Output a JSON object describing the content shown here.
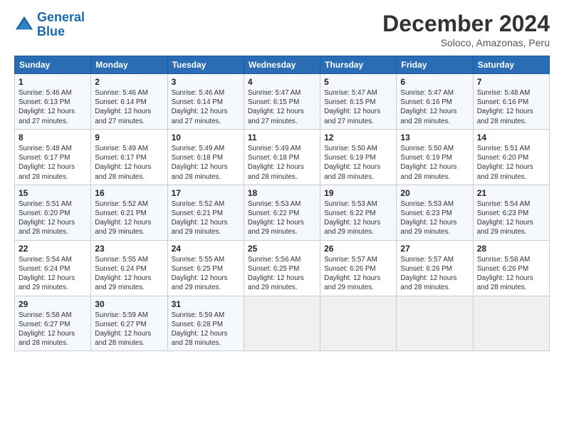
{
  "header": {
    "logo_line1": "General",
    "logo_line2": "Blue",
    "title": "December 2024",
    "subtitle": "Soloco, Amazonas, Peru"
  },
  "days_of_week": [
    "Sunday",
    "Monday",
    "Tuesday",
    "Wednesday",
    "Thursday",
    "Friday",
    "Saturday"
  ],
  "weeks": [
    [
      {
        "day": "1",
        "info": "Sunrise: 5:46 AM\nSunset: 6:13 PM\nDaylight: 12 hours\nand 27 minutes."
      },
      {
        "day": "2",
        "info": "Sunrise: 5:46 AM\nSunset: 6:14 PM\nDaylight: 12 hours\nand 27 minutes."
      },
      {
        "day": "3",
        "info": "Sunrise: 5:46 AM\nSunset: 6:14 PM\nDaylight: 12 hours\nand 27 minutes."
      },
      {
        "day": "4",
        "info": "Sunrise: 5:47 AM\nSunset: 6:15 PM\nDaylight: 12 hours\nand 27 minutes."
      },
      {
        "day": "5",
        "info": "Sunrise: 5:47 AM\nSunset: 6:15 PM\nDaylight: 12 hours\nand 27 minutes."
      },
      {
        "day": "6",
        "info": "Sunrise: 5:47 AM\nSunset: 6:16 PM\nDaylight: 12 hours\nand 28 minutes."
      },
      {
        "day": "7",
        "info": "Sunrise: 5:48 AM\nSunset: 6:16 PM\nDaylight: 12 hours\nand 28 minutes."
      }
    ],
    [
      {
        "day": "8",
        "info": "Sunrise: 5:48 AM\nSunset: 6:17 PM\nDaylight: 12 hours\nand 28 minutes."
      },
      {
        "day": "9",
        "info": "Sunrise: 5:49 AM\nSunset: 6:17 PM\nDaylight: 12 hours\nand 28 minutes."
      },
      {
        "day": "10",
        "info": "Sunrise: 5:49 AM\nSunset: 6:18 PM\nDaylight: 12 hours\nand 28 minutes."
      },
      {
        "day": "11",
        "info": "Sunrise: 5:49 AM\nSunset: 6:18 PM\nDaylight: 12 hours\nand 28 minutes."
      },
      {
        "day": "12",
        "info": "Sunrise: 5:50 AM\nSunset: 6:19 PM\nDaylight: 12 hours\nand 28 minutes."
      },
      {
        "day": "13",
        "info": "Sunrise: 5:50 AM\nSunset: 6:19 PM\nDaylight: 12 hours\nand 28 minutes."
      },
      {
        "day": "14",
        "info": "Sunrise: 5:51 AM\nSunset: 6:20 PM\nDaylight: 12 hours\nand 28 minutes."
      }
    ],
    [
      {
        "day": "15",
        "info": "Sunrise: 5:51 AM\nSunset: 6:20 PM\nDaylight: 12 hours\nand 28 minutes."
      },
      {
        "day": "16",
        "info": "Sunrise: 5:52 AM\nSunset: 6:21 PM\nDaylight: 12 hours\nand 29 minutes."
      },
      {
        "day": "17",
        "info": "Sunrise: 5:52 AM\nSunset: 6:21 PM\nDaylight: 12 hours\nand 29 minutes."
      },
      {
        "day": "18",
        "info": "Sunrise: 5:53 AM\nSunset: 6:22 PM\nDaylight: 12 hours\nand 29 minutes."
      },
      {
        "day": "19",
        "info": "Sunrise: 5:53 AM\nSunset: 6:22 PM\nDaylight: 12 hours\nand 29 minutes."
      },
      {
        "day": "20",
        "info": "Sunrise: 5:53 AM\nSunset: 6:23 PM\nDaylight: 12 hours\nand 29 minutes."
      },
      {
        "day": "21",
        "info": "Sunrise: 5:54 AM\nSunset: 6:23 PM\nDaylight: 12 hours\nand 29 minutes."
      }
    ],
    [
      {
        "day": "22",
        "info": "Sunrise: 5:54 AM\nSunset: 6:24 PM\nDaylight: 12 hours\nand 29 minutes."
      },
      {
        "day": "23",
        "info": "Sunrise: 5:55 AM\nSunset: 6:24 PM\nDaylight: 12 hours\nand 29 minutes."
      },
      {
        "day": "24",
        "info": "Sunrise: 5:55 AM\nSunset: 6:25 PM\nDaylight: 12 hours\nand 29 minutes."
      },
      {
        "day": "25",
        "info": "Sunrise: 5:56 AM\nSunset: 6:25 PM\nDaylight: 12 hours\nand 29 minutes."
      },
      {
        "day": "26",
        "info": "Sunrise: 5:57 AM\nSunset: 6:26 PM\nDaylight: 12 hours\nand 29 minutes."
      },
      {
        "day": "27",
        "info": "Sunrise: 5:57 AM\nSunset: 6:26 PM\nDaylight: 12 hours\nand 28 minutes."
      },
      {
        "day": "28",
        "info": "Sunrise: 5:58 AM\nSunset: 6:26 PM\nDaylight: 12 hours\nand 28 minutes."
      }
    ],
    [
      {
        "day": "29",
        "info": "Sunrise: 5:58 AM\nSunset: 6:27 PM\nDaylight: 12 hours\nand 28 minutes."
      },
      {
        "day": "30",
        "info": "Sunrise: 5:59 AM\nSunset: 6:27 PM\nDaylight: 12 hours\nand 28 minutes."
      },
      {
        "day": "31",
        "info": "Sunrise: 5:59 AM\nSunset: 6:28 PM\nDaylight: 12 hours\nand 28 minutes."
      },
      {
        "day": "",
        "info": ""
      },
      {
        "day": "",
        "info": ""
      },
      {
        "day": "",
        "info": ""
      },
      {
        "day": "",
        "info": ""
      }
    ]
  ]
}
